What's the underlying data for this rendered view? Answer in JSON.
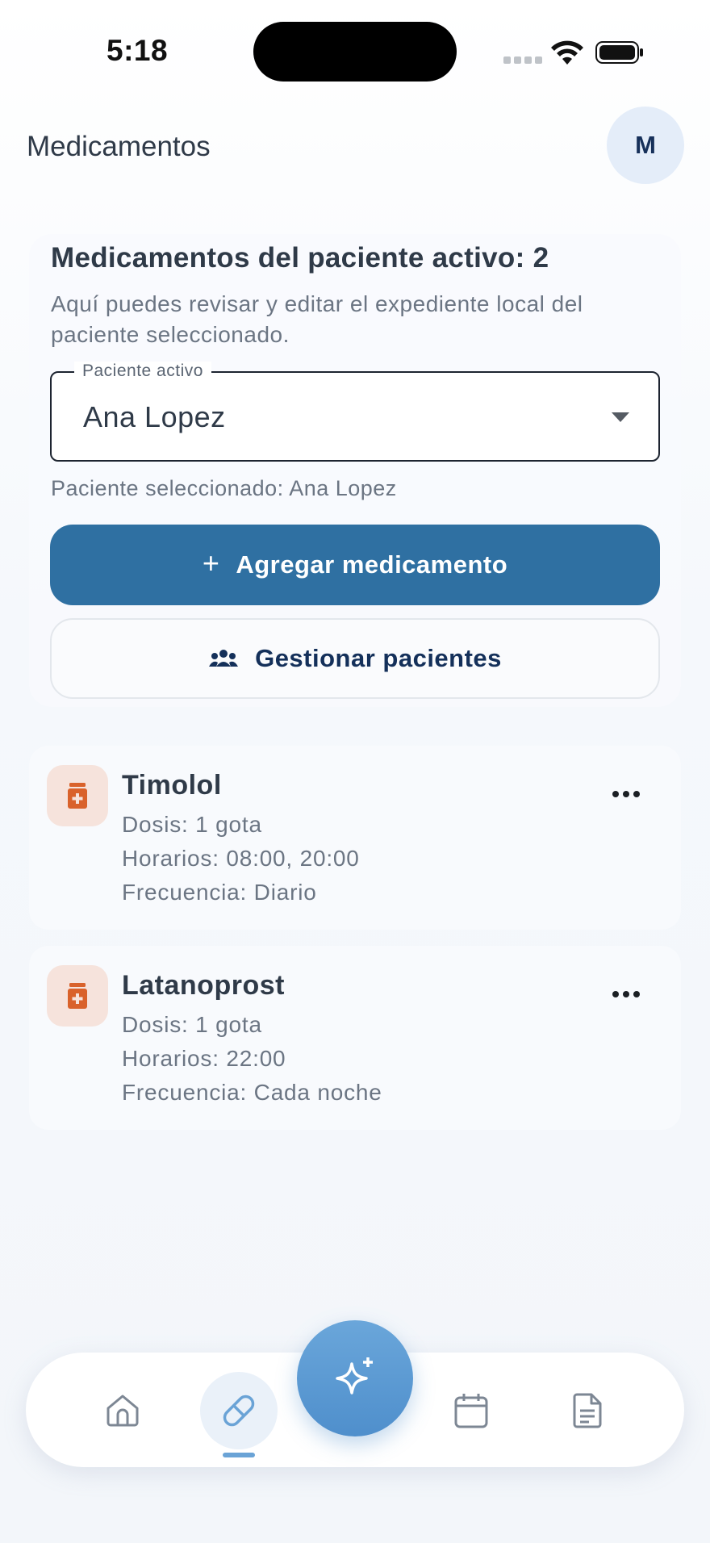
{
  "status_bar": {
    "time": "5:18"
  },
  "header": {
    "title": "Medicamentos",
    "avatar_initial": "M"
  },
  "summary": {
    "title": "Medicamentos del paciente activo: 2",
    "description": "Aquí puedes revisar y editar el expediente local del paciente seleccionado.",
    "select_label": "Paciente activo",
    "select_value": "Ana Lopez",
    "selected_text": "Paciente seleccionado: Ana Lopez",
    "add_button": "Agregar medicamento",
    "manage_button": "Gestionar pacientes"
  },
  "medications": [
    {
      "name": "Timolol",
      "dose": "Dosis: 1 gota",
      "schedule": "Horarios: 08:00, 20:00",
      "frequency": "Frecuencia: Diario"
    },
    {
      "name": "Latanoprost",
      "dose": "Dosis: 1 gota",
      "schedule": "Horarios: 22:00",
      "frequency": "Frecuencia: Cada noche"
    }
  ],
  "bottom_nav": {
    "items": [
      "home-icon",
      "pill-icon",
      "sparkle-icon",
      "calendar-icon",
      "document-icon"
    ],
    "active": "pill-icon"
  },
  "colors": {
    "primary": "#2f70a2",
    "accent": "#4f8fcc",
    "med_icon": "#d9622b"
  }
}
